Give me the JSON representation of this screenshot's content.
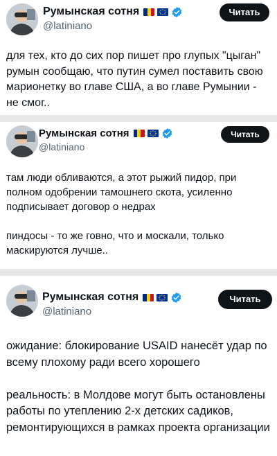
{
  "colors": {
    "button_bg": "#0f1419",
    "verified_blue": "#1d9bf0",
    "handle_gray": "#536471",
    "separator_gray": "#e7e7e7"
  },
  "posts": [
    {
      "author_name": "Румынская сотня",
      "handle": "@latiniano",
      "read_button": "Читать",
      "paragraphs": [
        "для тех, кто до сих пор пишет про глупых \"цыган\" румын сообщаю, что путин сумел поставить свою марионетку во главе США, а во главе Румынии - не смог.."
      ]
    },
    {
      "author_name": "Румынская сотня",
      "handle": "@latiniano",
      "read_button": "Читать",
      "paragraphs": [
        "там люди обливаются, а этот рыжий пидор, при полном одобрении тамошнего скота, усиленно подписывает договор о недрах",
        "пиндосы - то же говно, что и москали, только маскируются лучше.."
      ]
    },
    {
      "author_name": "Румынская сотня",
      "handle": "@latiniano",
      "read_button": "Читать",
      "paragraphs": [
        "ожидание: блокирование USAID нанесёт удар по всему плохому ради всего хорошего",
        "реальность: в Молдове могут быть остановлены работы по утеплению 2-х детских садиков, ремонтирующихся в рамках проекта организации"
      ]
    }
  ]
}
